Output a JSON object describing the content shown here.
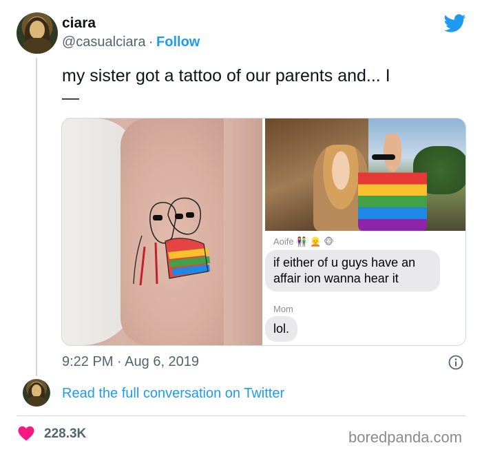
{
  "author": {
    "name": "ciara",
    "handle": "@casualciara",
    "separator": "·",
    "follow_label": "Follow"
  },
  "tweet": {
    "text_line1": "my sister got a tattoo of our parents and... I",
    "text_line2": "—"
  },
  "media": {
    "chat": {
      "sender1": "Aoife",
      "sender1_emojis": "👫 👱 🐵",
      "message1": "if either of u guys have an affair ion wanna hear it",
      "sender2": "Mom",
      "message2": "lol."
    }
  },
  "timestamp": {
    "time": "9:22 PM",
    "separator": "·",
    "date": "Aug 6, 2019"
  },
  "conversation_link": "Read the full conversation on Twitter",
  "likes": "228.3K",
  "watermark": "boredpanda.com",
  "colors": {
    "twitter_blue": "#1d9bf0",
    "heart_pink": "#f91880"
  },
  "icons": [
    "twitter-bird-icon",
    "info-icon",
    "heart-icon"
  ]
}
